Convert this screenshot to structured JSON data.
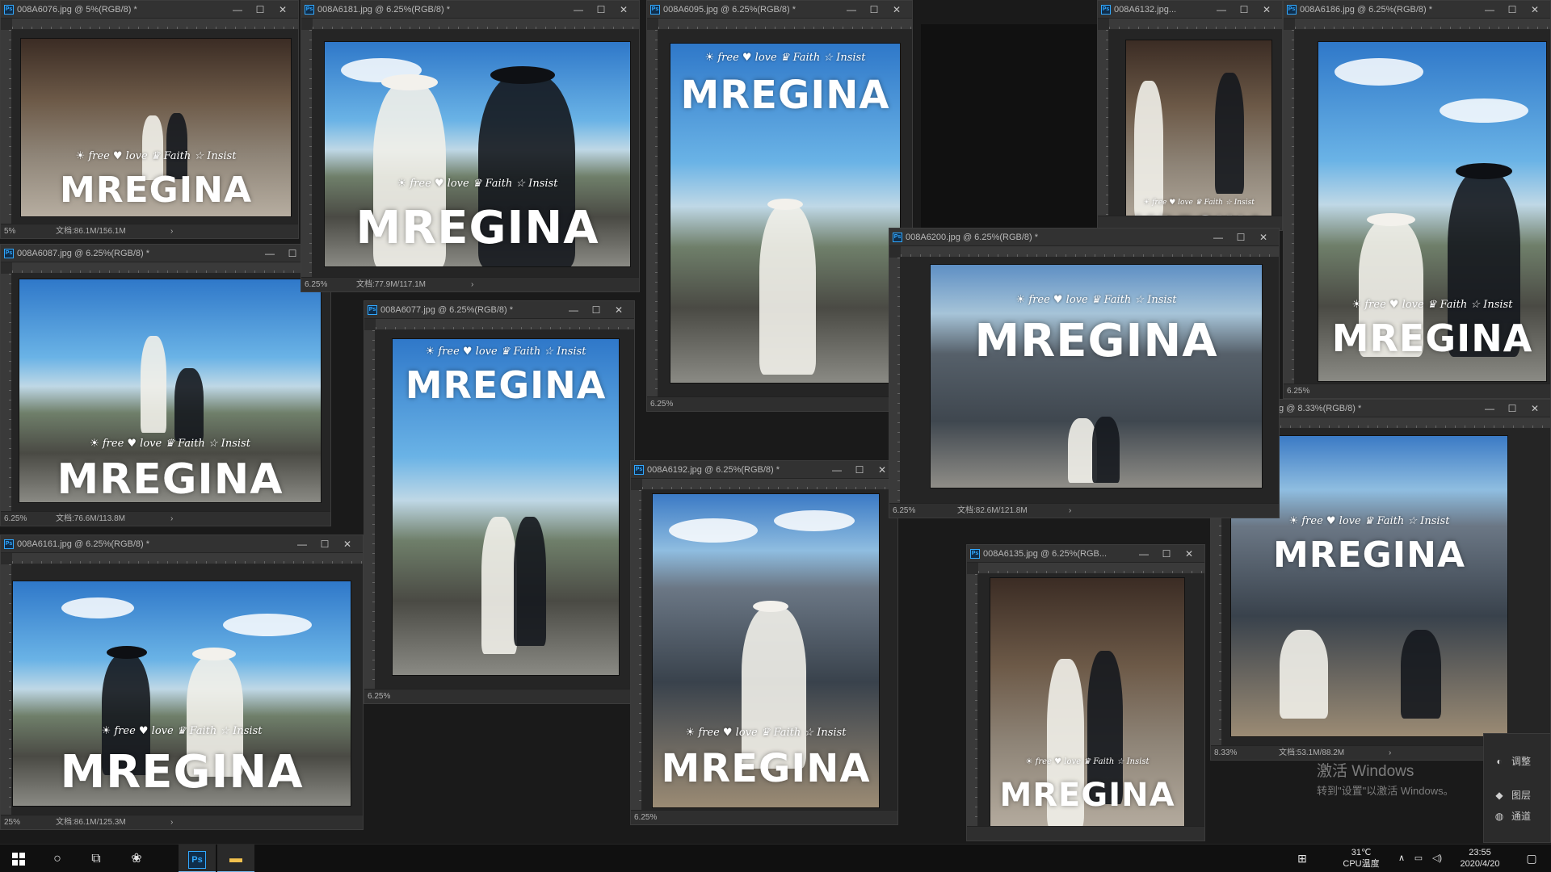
{
  "brand": {
    "logo_text": "MREGINA",
    "tagline": "☀ free ♥ love ♛ Faith ☆ Insist"
  },
  "windows": [
    {
      "title": "008A6076.jpg @ 5%(RGB/8) *",
      "zoom": "5%",
      "docsize": "文档:86.1M/156.1M"
    },
    {
      "title": "008A6181.jpg @ 6.25%(RGB/8) *",
      "zoom": "6.25%",
      "docsize": "文档:77.9M/117.1M"
    },
    {
      "title": "008A6095.jpg @ 6.25%(RGB/8) *",
      "zoom": "6.25%",
      "docsize": ""
    },
    {
      "title": "008A6132.jpg...",
      "zoom": "",
      "docsize": ""
    },
    {
      "title": "008A6186.jpg @ 6.25%(RGB/8) *",
      "zoom": "6.25%",
      "docsize": ""
    },
    {
      "title": "008A6087.jpg @ 6.25%(RGB/8) *",
      "zoom": "6.25%",
      "docsize": "文档:76.6M/113.8M"
    },
    {
      "title": "008A6077.jpg @ 6.25%(RGB/8) *",
      "zoom": "6.25%",
      "docsize": ""
    },
    {
      "title": "008A6200.jpg @ 6.25%(RGB/8) *",
      "zoom": "6.25%",
      "docsize": "文档:82.6M/121.8M"
    },
    {
      "title": "g @ 8.33%(RGB/8) *",
      "zoom": "8.33%",
      "docsize": "文档:53.1M/88.2M"
    },
    {
      "title": "008A6192.jpg @ 6.25%(RGB/8) *",
      "zoom": "6.25%",
      "docsize": ""
    },
    {
      "title": "008A6161.jpg @ 6.25%(RGB/8) *",
      "zoom": "25%",
      "docsize": "文档:86.1M/125.3M"
    },
    {
      "title": "008A6135.jpg @ 6.25%(RGB...",
      "zoom": "",
      "docsize": ""
    }
  ],
  "controls": {
    "minimize": "—",
    "maximize": "☐",
    "close": "✕",
    "status_arrow": "›"
  },
  "panels": {
    "adjust": "调整",
    "layers": "图层",
    "channels": "通道",
    "adjust_icon": "◐",
    "layers_icon": "◆",
    "channels_icon": "◍"
  },
  "watermark": {
    "line1": "激活 Windows",
    "line2": "转到\"设置\"以激活 Windows。"
  },
  "taskbar": {
    "search_icon": "○",
    "taskview_icon": "⧉",
    "app_icon": "❀",
    "ps_label": "Ps",
    "explorer_icon": "▬",
    "tray_grid": "⊞",
    "temperature": "31℃",
    "cpu_label": "CPU温度",
    "tray_up": "∧",
    "network_icon": "▭",
    "volume_icon": "◁)",
    "time": "23:55",
    "date": "2020/4/20",
    "notification_icon": "▢"
  }
}
